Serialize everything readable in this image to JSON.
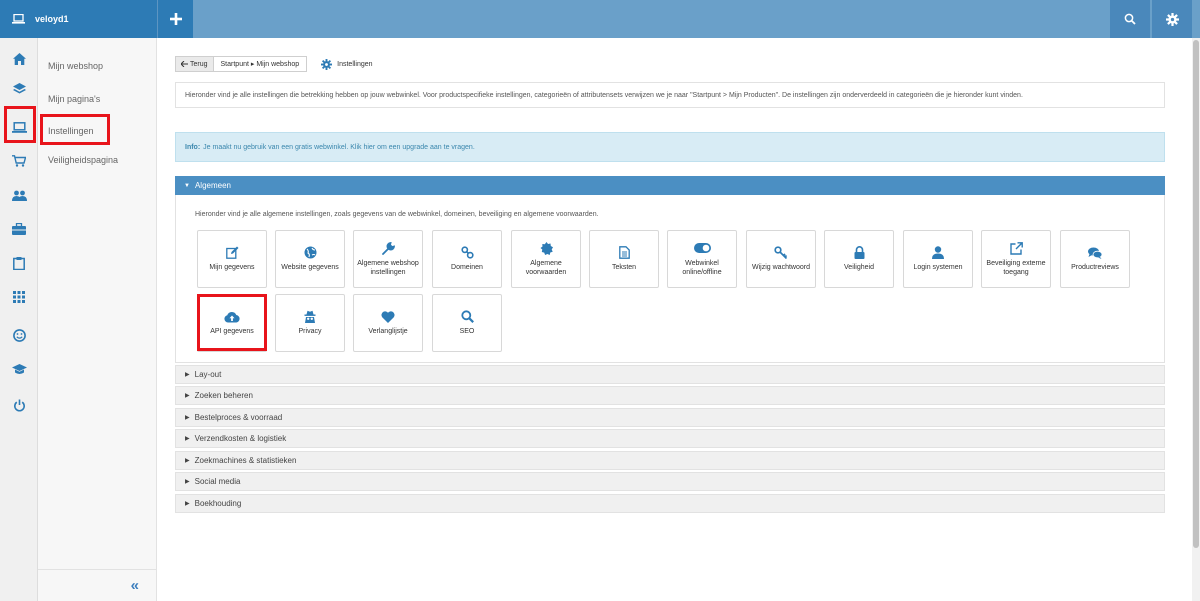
{
  "header": {
    "site_name": "veloyd1",
    "add_label": "+",
    "icons": [
      "laptop-icon",
      "plus-icon",
      "search-icon",
      "gear-icon"
    ]
  },
  "rail": {
    "icons": [
      "home-icon",
      "layers-icon",
      "laptop-icon",
      "cart-icon",
      "users-icon",
      "briefcase-icon",
      "clipboard-icon",
      "grid-icon",
      "smiley-icon",
      "graduation-cap-icon",
      "power-icon"
    ]
  },
  "submenu": {
    "items": [
      {
        "label": "Mijn webshop"
      },
      {
        "label": "Mijn pagina's"
      },
      {
        "label": "Instellingen"
      },
      {
        "label": "Veiligheidspagina"
      }
    ],
    "collapse_label": "«"
  },
  "breadcrumb": {
    "back_label": "Terug",
    "path": "Startpunt ▸ Mijn webshop",
    "page_title": "Instellingen"
  },
  "intro_text": "Hieronder vind je alle instellingen die betrekking hebben op jouw webwinkel. Voor productspecifieke instellingen, categorieën of attributensets verwijzen we je naar \"Startpunt > Mijn Producten\". De instellingen zijn onderverdeeld in categorieën die je hieronder kunt vinden.",
  "info": {
    "prefix": "Info:",
    "text": "Je maakt nu gebruik van een gratis webwinkel. Klik hier om een upgrade aan te vragen."
  },
  "panel": {
    "title": "Algemeen",
    "description": "Hieronder vind je alle algemene instellingen, zoals gegevens van de webwinkel, domeinen, beveiliging en algemene voorwaarden.",
    "tiles": [
      {
        "label": "Mijn gegevens",
        "icon": "edit-icon"
      },
      {
        "label": "Website gegevens",
        "icon": "globe-icon"
      },
      {
        "label": "Algemene webshop instellingen",
        "icon": "wrench-icon"
      },
      {
        "label": "Domeinen",
        "icon": "link-icon"
      },
      {
        "label": "Algemene voorwaarden",
        "icon": "certificate-icon"
      },
      {
        "label": "Teksten",
        "icon": "file-icon"
      },
      {
        "label": "Webwinkel online/offline",
        "icon": "toggle-icon"
      },
      {
        "label": "Wijzig wachtwoord",
        "icon": "key-icon"
      },
      {
        "label": "Veiligheid",
        "icon": "lock-icon"
      },
      {
        "label": "Login systemen",
        "icon": "user-icon"
      },
      {
        "label": "Beveiliging externe toegang",
        "icon": "external-link-icon"
      },
      {
        "label": "Productreviews",
        "icon": "comments-icon"
      },
      {
        "label": "API gegevens",
        "icon": "cloud-upload-icon"
      },
      {
        "label": "Privacy",
        "icon": "spy-icon"
      },
      {
        "label": "Verlanglijstje",
        "icon": "heart-icon"
      },
      {
        "label": "SEO",
        "icon": "search-icon"
      }
    ]
  },
  "sections": [
    {
      "label": "Lay-out"
    },
    {
      "label": "Zoeken beheren"
    },
    {
      "label": "Bestelproces & voorraad"
    },
    {
      "label": "Verzendkosten & logistiek"
    },
    {
      "label": "Zoekmachines & statistieken"
    },
    {
      "label": "Social media"
    },
    {
      "label": "Boekhouding"
    }
  ],
  "colors": {
    "brand": "#2d7bb5",
    "topbar": "#6aa0c9",
    "accent": "#3a7dbd",
    "highlight": "#e8141b",
    "info_bg": "#d8ecf5"
  }
}
